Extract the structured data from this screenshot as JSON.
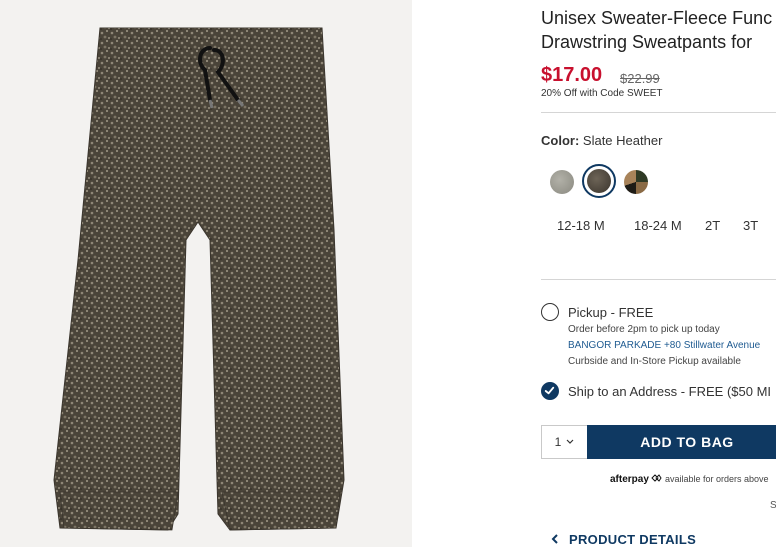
{
  "product": {
    "title_line1": "Unisex Sweater-Fleece Func",
    "title_line2": "Drawstring Sweatpants for",
    "price": "$17.00",
    "original_price": "$22.99",
    "promo": "20% Off with Code SWEET"
  },
  "color": {
    "label": "Color:",
    "selected": "Slate Heather",
    "swatches": [
      {
        "name": "light-heather",
        "hex": "#9a9a92"
      },
      {
        "name": "slate-heather",
        "hex": "#4e463d"
      },
      {
        "name": "camo",
        "hex": "#6e5638"
      }
    ]
  },
  "sizes": [
    "12-18 M",
    "18-24 M",
    "2T",
    "3T"
  ],
  "fulfillment": {
    "pickup_title": "Pickup - FREE",
    "pickup_line1": "Order before 2pm to pick up today",
    "pickup_store": "BANGOR PARKADE +80 Stillwater Avenue",
    "pickup_line3": "Curbside and In-Store Pickup available",
    "ship_label": "Ship to an Address - FREE ($50 MI"
  },
  "cart": {
    "quantity": "1",
    "add_label": "ADD TO BAG"
  },
  "afterpay": {
    "brand": "afterpay",
    "text": "available for orders above"
  },
  "stray_char": "S",
  "details_label": "PRODUCT DETAILS",
  "colors": {
    "brand_navy": "#0f3962",
    "sale_red": "#c8102e"
  }
}
